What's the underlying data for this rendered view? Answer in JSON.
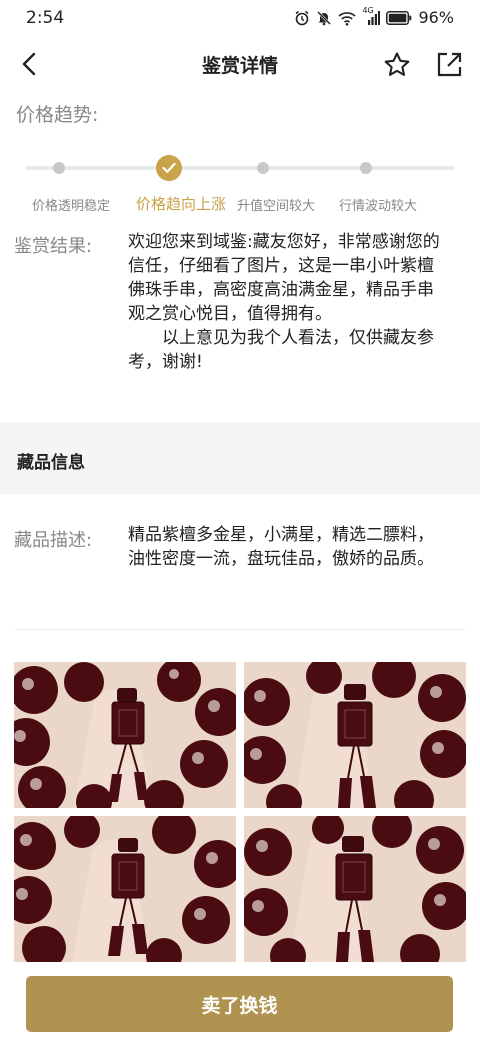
{
  "status_bar": {
    "time": "2:54",
    "network": "4G",
    "battery": "96%",
    "icons": [
      "alarm-icon",
      "mute-icon",
      "wifi-icon",
      "signal-icon",
      "battery-icon"
    ]
  },
  "nav": {
    "title": "鉴赏详情",
    "icons": [
      "back-arrow-icon",
      "star-icon",
      "share-icon"
    ]
  },
  "price_trend": {
    "label": "价格趋势:",
    "options": [
      "价格透明稳定",
      "价格趋向上涨",
      "升值空间较大",
      "行情波动较大"
    ],
    "selected_index": 1,
    "accent_color": "#c9a24a"
  },
  "appraisal": {
    "label": "鉴赏结果:",
    "paragraph1": "欢迎您来到域鉴:藏友您好，非常感谢您的信任，仔细看了图片，这是一串小叶紫檀佛珠手串，高密度高油满金星，精品手串观之赏心悦目，值得拥有。",
    "paragraph2": "以上意见为我个人看法，仅供藏友参考，谢谢!"
  },
  "collection_info": {
    "section_title": "藏品信息",
    "desc_label": "藏品描述:",
    "desc_text": "精品紫檀多金星，小满星，精选二膘料，油性密度一流，盘玩佳品，傲娇的品质。"
  },
  "photos": {
    "count": 4
  },
  "bottom": {
    "sell_label": "卖了换钱",
    "button_color": "#b19351"
  }
}
